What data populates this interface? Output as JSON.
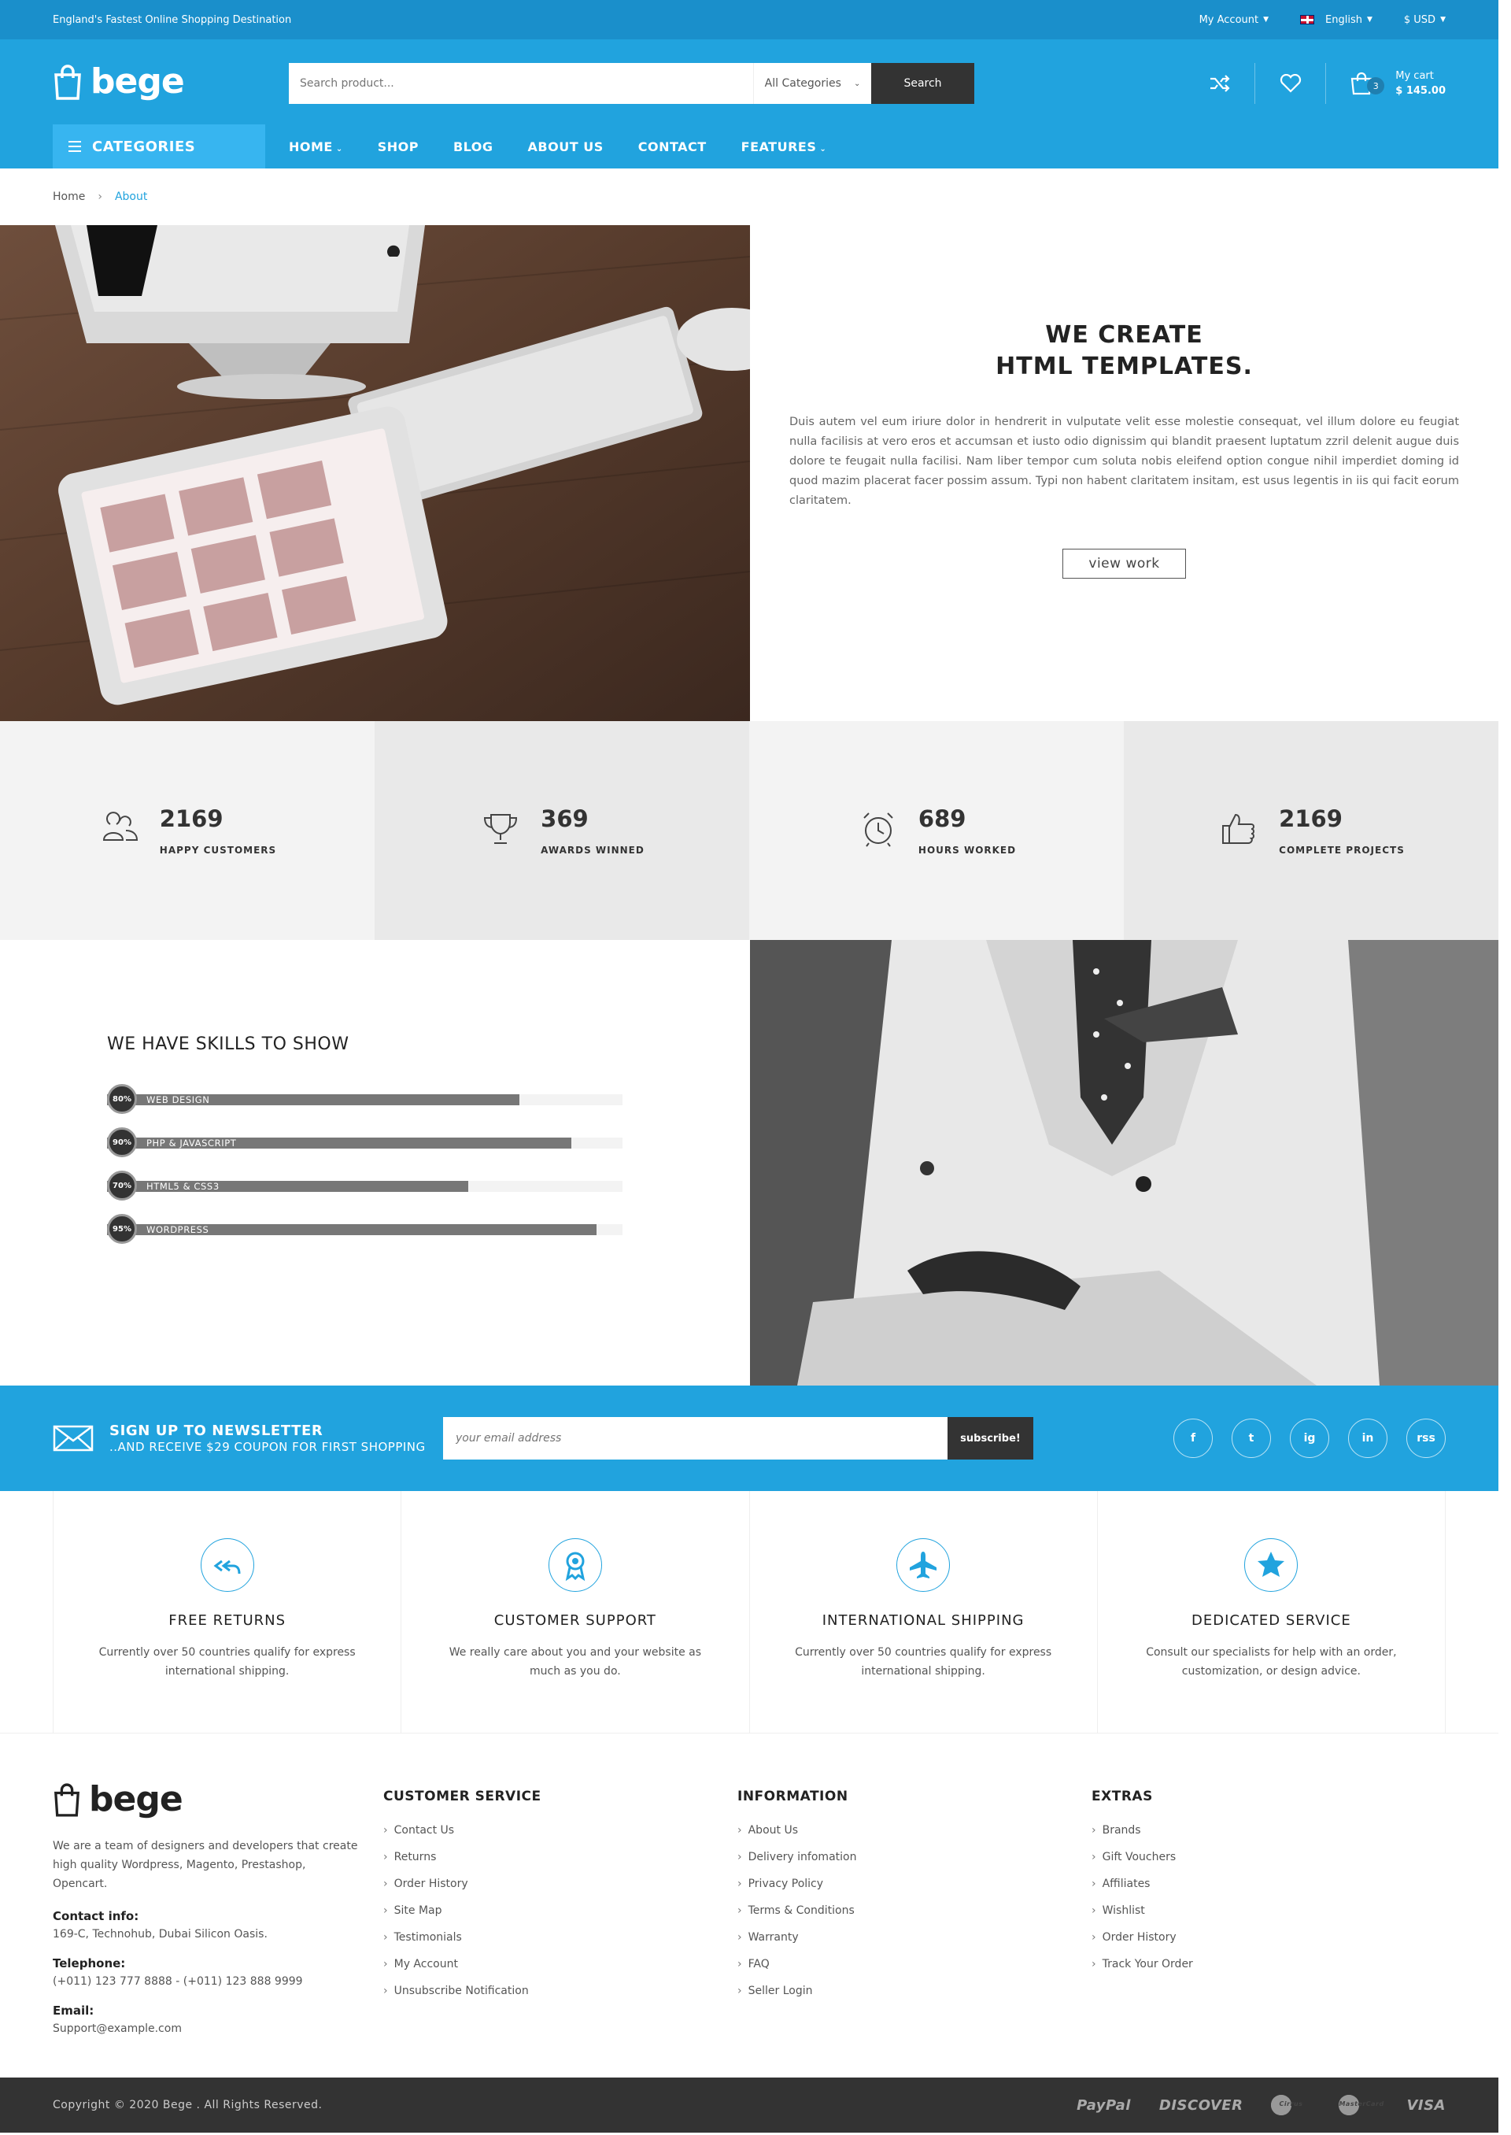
{
  "topbar": {
    "tagline": "England's Fastest Online Shopping Destination",
    "account": "My Account",
    "language": "English",
    "currency": "$ USD"
  },
  "header": {
    "brand": "bege",
    "search_placeholder": "Search product...",
    "category": "All Categories",
    "search_button": "Search",
    "cart_count": "3",
    "cart_label": "My cart",
    "cart_total": "$ 145.00"
  },
  "nav": {
    "categories": "CATEGORIES",
    "items": [
      {
        "label": "HOME",
        "dropdown": true
      },
      {
        "label": "SHOP",
        "dropdown": false
      },
      {
        "label": "BLOG",
        "dropdown": false
      },
      {
        "label": "ABOUT US",
        "dropdown": false
      },
      {
        "label": "CONTACT",
        "dropdown": false
      },
      {
        "label": "FEATURES",
        "dropdown": true
      }
    ]
  },
  "breadcrumb": {
    "home": "Home",
    "current": "About"
  },
  "hero": {
    "title_line1": "WE CREATE",
    "title_line2": "HTML TEMPLATES.",
    "body": "Duis autem vel eum iriure dolor in hendrerit in vulputate velit esse molestie consequat, vel illum dolore eu feugiat nulla facilisis at vero eros et accumsan et iusto odio dignissim qui blandit praesent luptatum zzril delenit augue duis dolore te feugait nulla facilisi. Nam liber tempor cum soluta nobis eleifend option congue nihil imperdiet doming id quod mazim placerat facer possim assum. Typi non habent claritatem insitam, est usus legentis in iis qui facit eorum claritatem.",
    "button": "view work"
  },
  "counters": [
    {
      "icon": "users-icon",
      "value": "2169",
      "label": "HAPPY CUSTOMERS"
    },
    {
      "icon": "trophy-icon",
      "value": "369",
      "label": "AWARDS WINNED"
    },
    {
      "icon": "alarm-clock-icon",
      "value": "689",
      "label": "HOURS WORKED"
    },
    {
      "icon": "thumbs-up-icon",
      "value": "2169",
      "label": "COMPLETE PROJECTS"
    }
  ],
  "skills": {
    "title": "WE HAVE SKILLS TO SHOW",
    "items": [
      {
        "name": "WEB DESIGN",
        "percent": 80,
        "label": "80%"
      },
      {
        "name": "PHP & JAVASCRIPT",
        "percent": 90,
        "label": "90%"
      },
      {
        "name": "HTML5 & CSS3",
        "percent": 70,
        "label": "70%"
      },
      {
        "name": "WORDPRESS",
        "percent": 95,
        "label": "95%"
      }
    ]
  },
  "newsletter": {
    "title": "SIGN UP TO NEWSLETTER",
    "subtitle": "..AND RECEIVE $29 COUPON FOR FIRST SHOPPING",
    "placeholder": "your email address",
    "button": "subscribe!",
    "social": [
      "f",
      "t",
      "ig",
      "in",
      "rss"
    ]
  },
  "services": [
    {
      "icon": "return-arrow-icon",
      "title": "FREE RETURNS",
      "text": "Currently over 50 countries qualify for express international shipping."
    },
    {
      "icon": "award-ribbon-icon",
      "title": "CUSTOMER SUPPORT",
      "text": "We really care about you and your website as much as you do."
    },
    {
      "icon": "airplane-icon",
      "title": "INTERNATIONAL SHIPPING",
      "text": "Currently over 50 countries qualify for express international shipping."
    },
    {
      "icon": "star-icon",
      "title": "DEDICATED SERVICE",
      "text": "Consult our specialists for help with an order, customization, or design advice."
    }
  ],
  "footer": {
    "brand": "bege",
    "about": "We are a team of designers and developers that create high quality Wordpress, Magento, Prestashop, Opencart.",
    "contact_label": "Contact info:",
    "contact": "169-C, Technohub, Dubai Silicon Oasis.",
    "phone_label": "Telephone:",
    "phone": "(+011) 123 777 8888 - (+011) 123 888 9999",
    "email_label": "Email:",
    "email": "Support@example.com",
    "columns": [
      {
        "title": "CUSTOMER SERVICE",
        "links": [
          "Contact Us",
          "Returns",
          "Order History",
          "Site Map",
          "Testimonials",
          "My Account",
          "Unsubscribe Notification"
        ]
      },
      {
        "title": "INFORMATION",
        "links": [
          "About Us",
          "Delivery infomation",
          "Privacy Policy",
          "Terms & Conditions",
          "Warranty",
          "FAQ",
          "Seller Login"
        ]
      },
      {
        "title": "EXTRAS",
        "links": [
          "Brands",
          "Gift Vouchers",
          "Affiliates",
          "Wishlist",
          "Order History",
          "Track Your Order"
        ]
      }
    ],
    "copyright": "Copyright © 2020 Bege . All Rights Reserved.",
    "payments": [
      "PayPal",
      "DISCOVER",
      "Cirrus",
      "MasterCard",
      "VISA"
    ]
  }
}
